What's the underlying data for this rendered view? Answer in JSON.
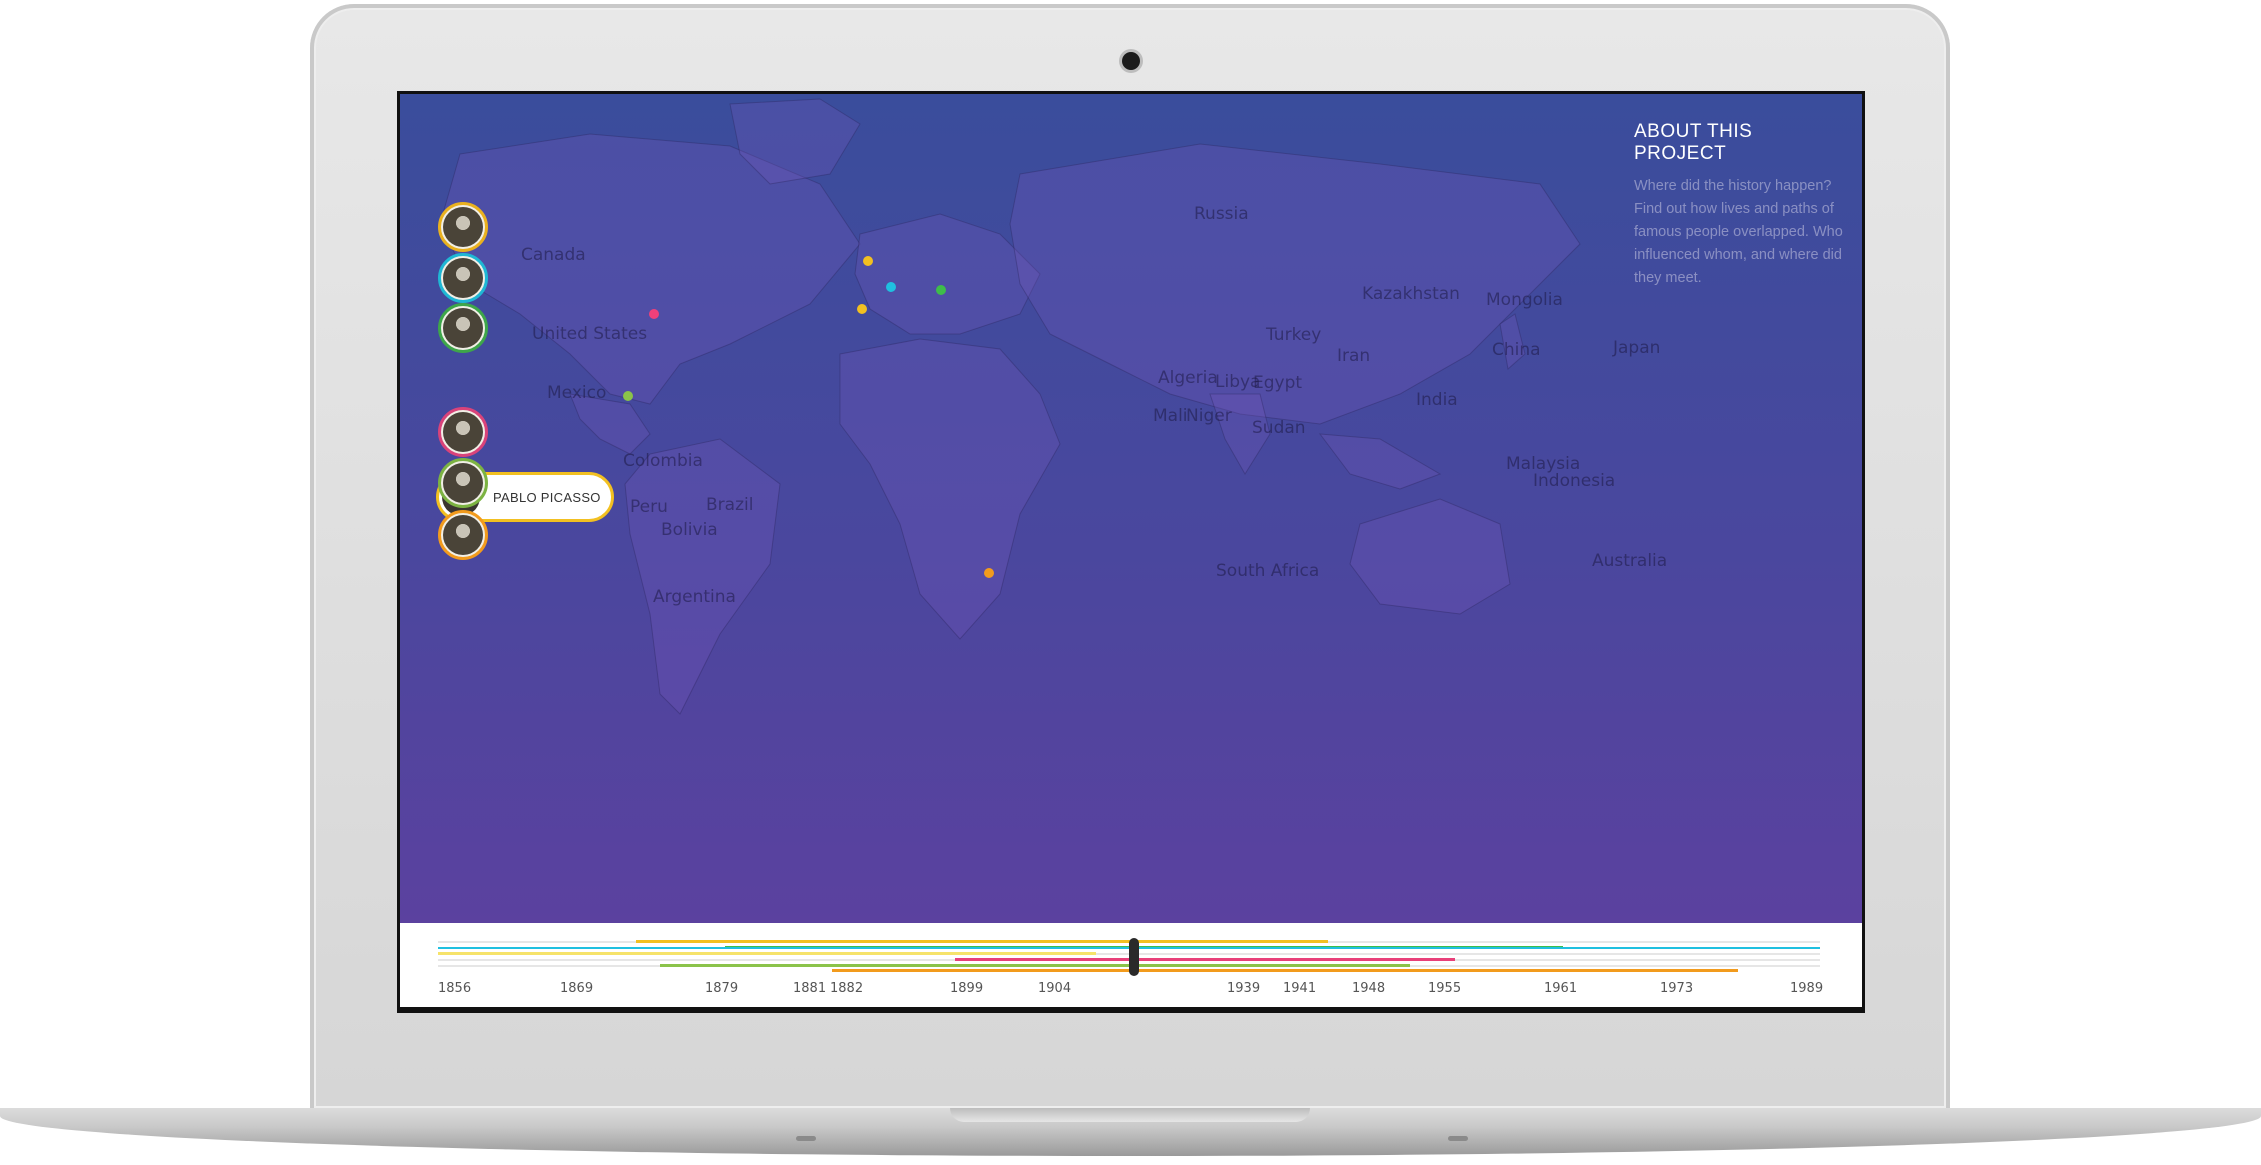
{
  "about": {
    "title": "ABOUT THIS PROJECT",
    "text": "Where did the history happen? Find out how lives and paths of famous people overlapped. Who influenced whom, and where did they meet."
  },
  "countries": [
    "Russia",
    "Canada",
    "Kazakhstan",
    "Mongolia",
    "United States",
    "Turkey",
    "China",
    "Iran",
    "Japan",
    "Algeria",
    "Libya",
    "Egypt",
    "Mexico",
    "Mali",
    "Niger",
    "India",
    "Sudan",
    "Colombia",
    "Malaysia",
    "Indonesia",
    "Peru",
    "Brazil",
    "Bolivia",
    "Australia",
    "South Africa",
    "Argentina"
  ],
  "people": [
    {
      "name": "",
      "ring": "#e9b11f"
    },
    {
      "name": "",
      "ring": "#1fb7d4"
    },
    {
      "name": "",
      "ring": "#3ea64a"
    },
    {
      "name": "PABLO PICASSO",
      "ring": "#f2c021"
    },
    {
      "name": "",
      "ring": "#d9437a"
    },
    {
      "name": "",
      "ring": "#7cb342"
    },
    {
      "name": "",
      "ring": "#f29b1d"
    }
  ],
  "dots": [
    {
      "color": "#f2c021"
    },
    {
      "color": "#1fc0e0"
    },
    {
      "color": "#3ebd4a"
    },
    {
      "color": "#f2c021"
    },
    {
      "color": "#f0407a"
    },
    {
      "color": "#8bc34a"
    },
    {
      "color": "#f29b1d"
    }
  ],
  "timeline": {
    "years": [
      "1856",
      "1869",
      "1879",
      "1881",
      "1882",
      "1899",
      "1904",
      "1939",
      "1941",
      "1948",
      "1955",
      "1961",
      "1973",
      "1989"
    ]
  }
}
